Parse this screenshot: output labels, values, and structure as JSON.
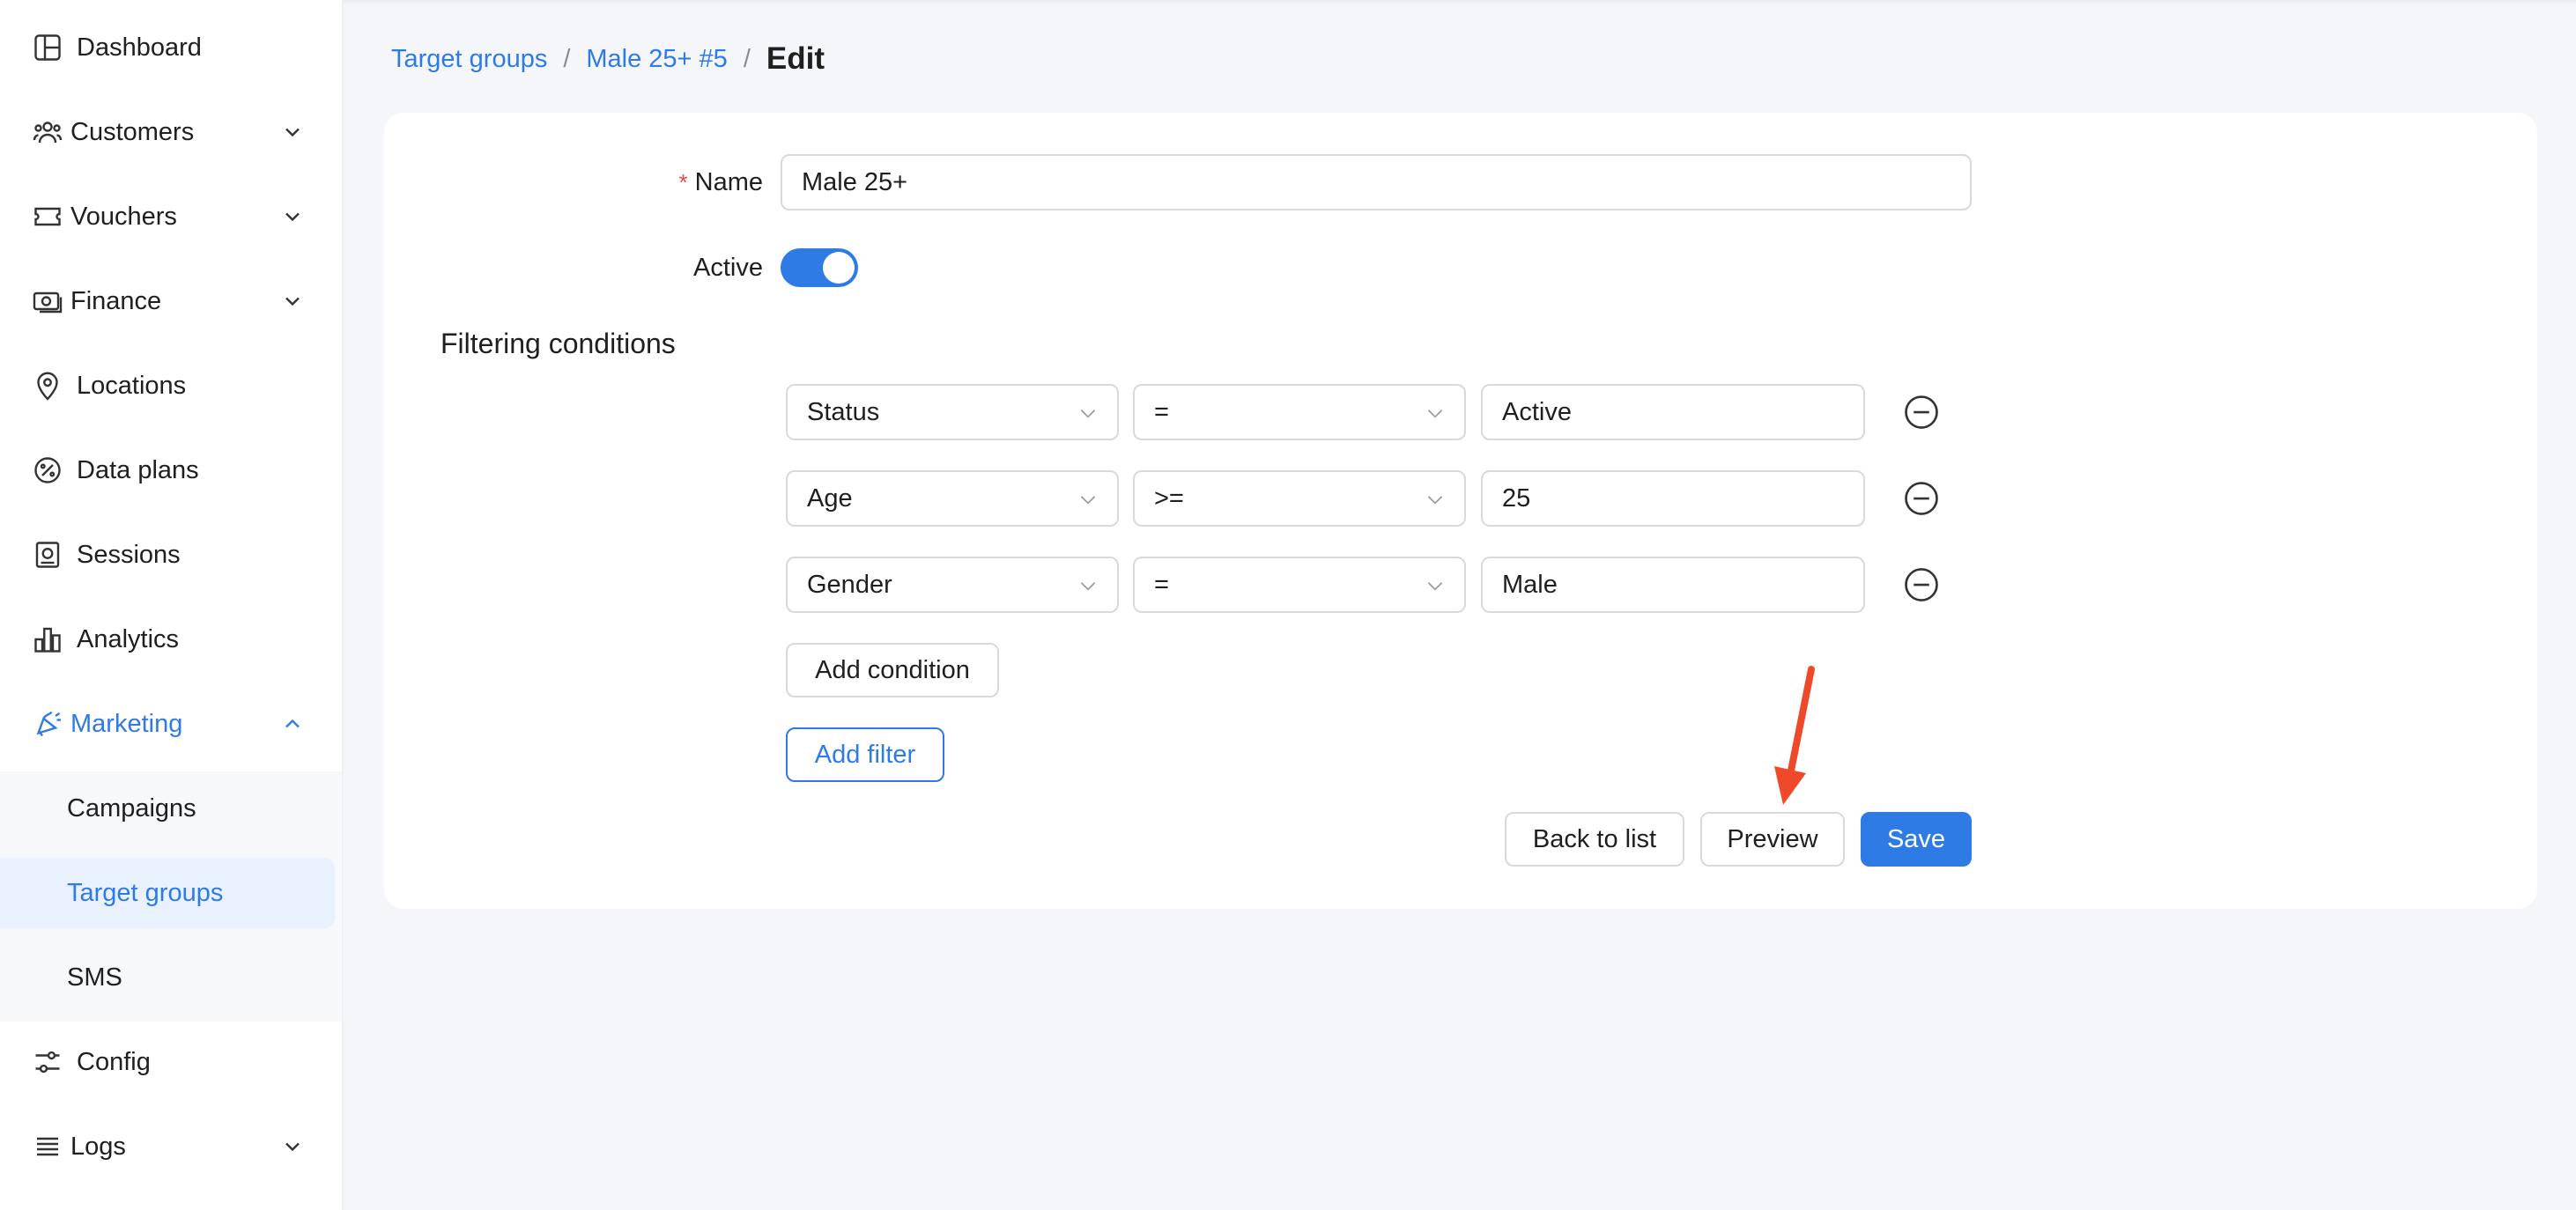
{
  "sidebar": {
    "items": [
      {
        "label": "Dashboard",
        "icon": "dashboard-icon"
      },
      {
        "label": "Customers",
        "icon": "customers-icon",
        "expandable": true
      },
      {
        "label": "Vouchers",
        "icon": "voucher-icon",
        "expandable": true
      },
      {
        "label": "Finance",
        "icon": "finance-icon",
        "expandable": true
      },
      {
        "label": "Locations",
        "icon": "location-pin-icon"
      },
      {
        "label": "Data plans",
        "icon": "data-plans-icon"
      },
      {
        "label": "Sessions",
        "icon": "sessions-icon"
      },
      {
        "label": "Analytics",
        "icon": "analytics-icon"
      },
      {
        "label": "Marketing",
        "icon": "marketing-icon",
        "expandable": true,
        "expanded": true
      },
      {
        "label": "Config",
        "icon": "config-sliders-icon"
      },
      {
        "label": "Logs",
        "icon": "logs-icon",
        "expandable": true
      }
    ],
    "marketing_submenu": [
      {
        "label": "Campaigns"
      },
      {
        "label": "Target groups",
        "selected": true
      },
      {
        "label": "SMS"
      }
    ]
  },
  "breadcrumb": {
    "root": "Target groups",
    "group": "Male 25+ #5",
    "current": "Edit",
    "separator": "/"
  },
  "form": {
    "name_label": "Name",
    "name_required_mark": "*",
    "name_value": "Male 25+",
    "active_label": "Active",
    "active_on": true,
    "filtering_title": "Filtering conditions",
    "conditions": [
      {
        "field": "Status",
        "operator": "=",
        "value": "Active"
      },
      {
        "field": "Age",
        "operator": ">=",
        "value": "25"
      },
      {
        "field": "Gender",
        "operator": "=",
        "value": "Male"
      }
    ],
    "add_condition_label": "Add condition",
    "add_filter_label": "Add filter"
  },
  "actions": {
    "back_label": "Back to list",
    "preview_label": "Preview",
    "save_label": "Save"
  },
  "colors": {
    "accent": "#2f7be5",
    "arrow": "#ee4a2a",
    "required": "#e5484d"
  }
}
